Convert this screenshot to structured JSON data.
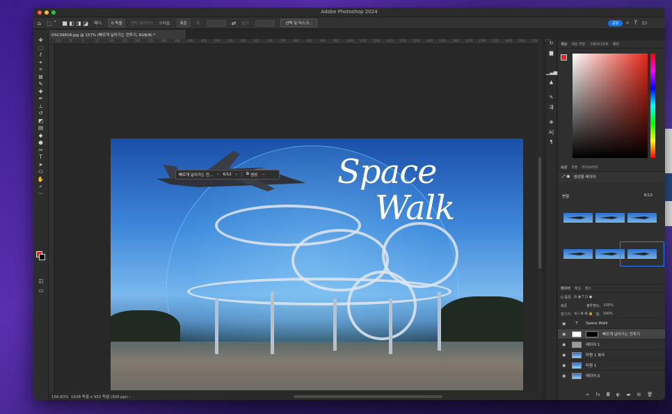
{
  "app": {
    "title": "Adobe Photoshop 2024"
  },
  "options_bar": {
    "feather_label": "페더:",
    "feather_value": "0 픽셀",
    "antialias_label": "앤티 앨리어스",
    "style_label": "스타일:",
    "style_value": "표준",
    "width_label": "폭:",
    "height_label": "높이:",
    "mask_button": "선택 및 마스크...",
    "share_button": "공유"
  },
  "document": {
    "tab_label": "DSC09818.jpg @ 157% (빠르게 날아가는 전투기, RGB/8) *",
    "zoom": "156.83%",
    "info": "1528 픽셀 x 933 픽셀 (300 ppi)"
  },
  "artwork": {
    "title_line1": "Space",
    "title_line2": "Walk"
  },
  "ruler_ticks": [
    "150",
    "50",
    "0",
    "50",
    "100",
    "150",
    "200",
    "250",
    "300",
    "350",
    "400",
    "450",
    "500",
    "550",
    "600",
    "650",
    "700",
    "750",
    "800",
    "850",
    "900",
    "950",
    "1000",
    "1050",
    "1100",
    "1150",
    "1200",
    "1250",
    "1300",
    "1350",
    "1400",
    "1450",
    "1500",
    "1550",
    "1600",
    "1650",
    "1700",
    "1750"
  ],
  "gen_bar": {
    "prompt": "빠르게 날아가는 전...",
    "page": "6/12",
    "generate": "생성",
    "more": "···"
  },
  "color_panel": {
    "tabs": [
      "색상",
      "색상 견본",
      "그레이디언트",
      "패턴"
    ],
    "fg": "#e02a1d"
  },
  "properties_panel": {
    "tabs": [
      "속성",
      "조정",
      "라이브러리"
    ],
    "layer_type": "생성형 레이어",
    "variations_label": "변형",
    "variations_count": "6/12"
  },
  "layers_panel": {
    "tabs": [
      "레이어",
      "채널",
      "패스"
    ],
    "filter_label": "Q 종류",
    "blend_mode": "표준",
    "opacity_label": "불투명도:",
    "opacity_value": "100%",
    "lock_label": "잠그기:",
    "fill_label": "칠:",
    "fill_value": "100%",
    "layers": [
      {
        "name": "Space      Walk",
        "type": "text"
      },
      {
        "name": "빠르게 날아가는 전투기",
        "type": "generative",
        "active": true
      },
      {
        "name": "레이어 1",
        "type": "gray"
      },
      {
        "name": "타원 1 복사",
        "type": "blue"
      },
      {
        "name": "타원 1",
        "type": "blue"
      },
      {
        "name": "레이어 0",
        "type": "blue"
      }
    ]
  }
}
